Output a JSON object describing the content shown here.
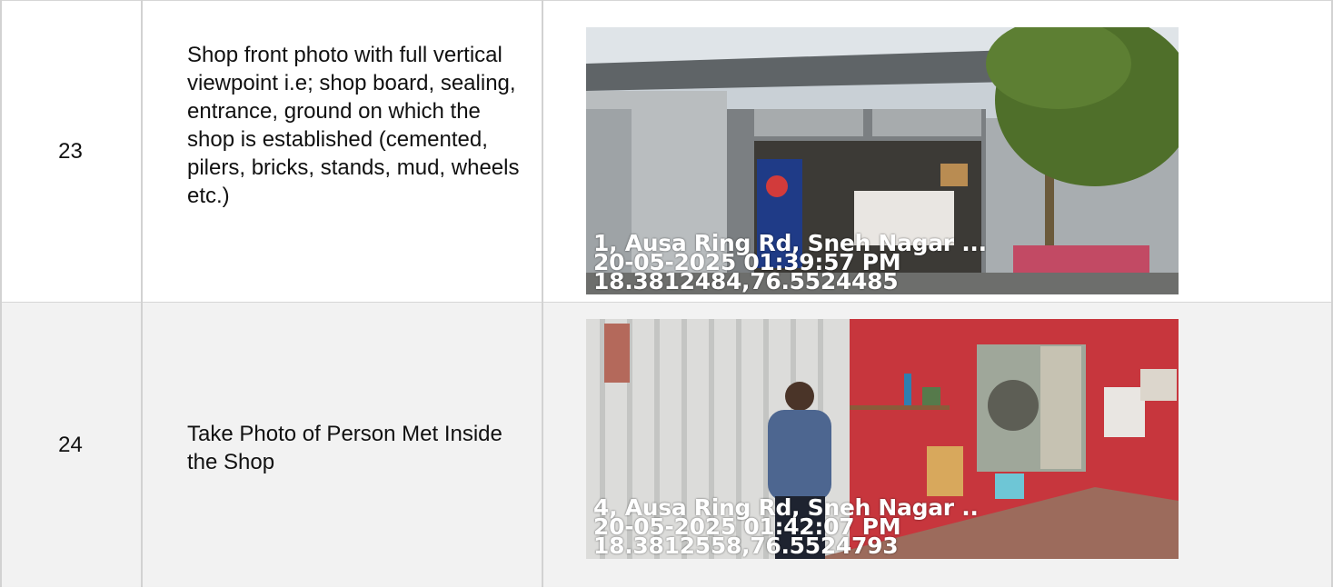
{
  "rows": [
    {
      "number": "23",
      "description": "Shop front photo with full vertical viewpoint i.e; shop board, sealing, entrance, ground on which the shop is established (cemented, pilers, bricks, stands, mud, wheels etc.)",
      "photo": {
        "address": "1, Ausa Ring Rd, Sneh Nagar ...",
        "datetime": "20-05-2025 01:39:57 PM",
        "coordinates": "18.3812484,76.5524485"
      }
    },
    {
      "number": "24",
      "description": "Take Photo of Person Met Inside the Shop",
      "photo": {
        "address": "4, Ausa Ring Rd, Sneh Nagar ..",
        "datetime": "20-05-2025 01:42:07 PM",
        "coordinates": "18.3812558,76.5524793"
      }
    }
  ]
}
